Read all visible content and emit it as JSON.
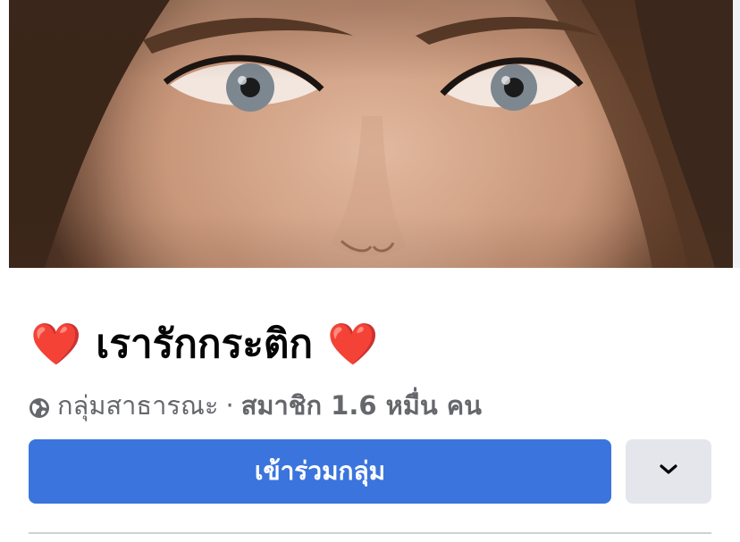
{
  "cover": {
    "alt": ""
  },
  "group": {
    "heart_left": "❤️",
    "name": "เรารักกระติก",
    "heart_right": "❤️",
    "privacy": "กลุ่มสาธารณะ",
    "separator": "·",
    "members": "สมาชิก 1.6 หมื่น คน"
  },
  "actions": {
    "join_label": "เข้าร่วมกลุ่ม"
  },
  "colors": {
    "primary": "#3b74dc",
    "secondary_bg": "#e4e6eb",
    "meta_text": "#65676b"
  },
  "icons": {
    "privacy": "globe-icon",
    "more": "chevron-down-icon"
  }
}
